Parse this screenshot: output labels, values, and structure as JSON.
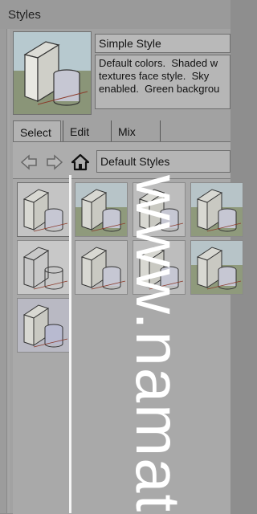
{
  "window": {
    "title": "Styles"
  },
  "style": {
    "name": "Simple Style",
    "description": "Default colors.  Shaded w\ntextures face style.  Sky\nenabled.  Green backgrou"
  },
  "tabs": [
    {
      "label": "Select"
    },
    {
      "label": "Edit"
    },
    {
      "label": "Mix"
    }
  ],
  "nav": {
    "back_icon": "left-arrow-icon",
    "forward_icon": "right-arrow-icon",
    "home_icon": "home-icon",
    "collection": "Default Styles"
  },
  "style_grid": [
    {
      "variant": "sketch"
    },
    {
      "variant": "green-sky"
    },
    {
      "variant": "shaded"
    },
    {
      "variant": "green-sky"
    },
    {
      "variant": "wireframe"
    },
    {
      "variant": "shaded"
    },
    {
      "variant": "shaded"
    },
    {
      "variant": "green-sky"
    },
    {
      "variant": "shaded-blue"
    }
  ],
  "watermark": {
    "text": "www.namat"
  },
  "colors": {
    "panel": "#a6a6a6",
    "field": "#b8b8b8",
    "border": "#6e6e6e",
    "cube_fill": "#c9cad4"
  }
}
